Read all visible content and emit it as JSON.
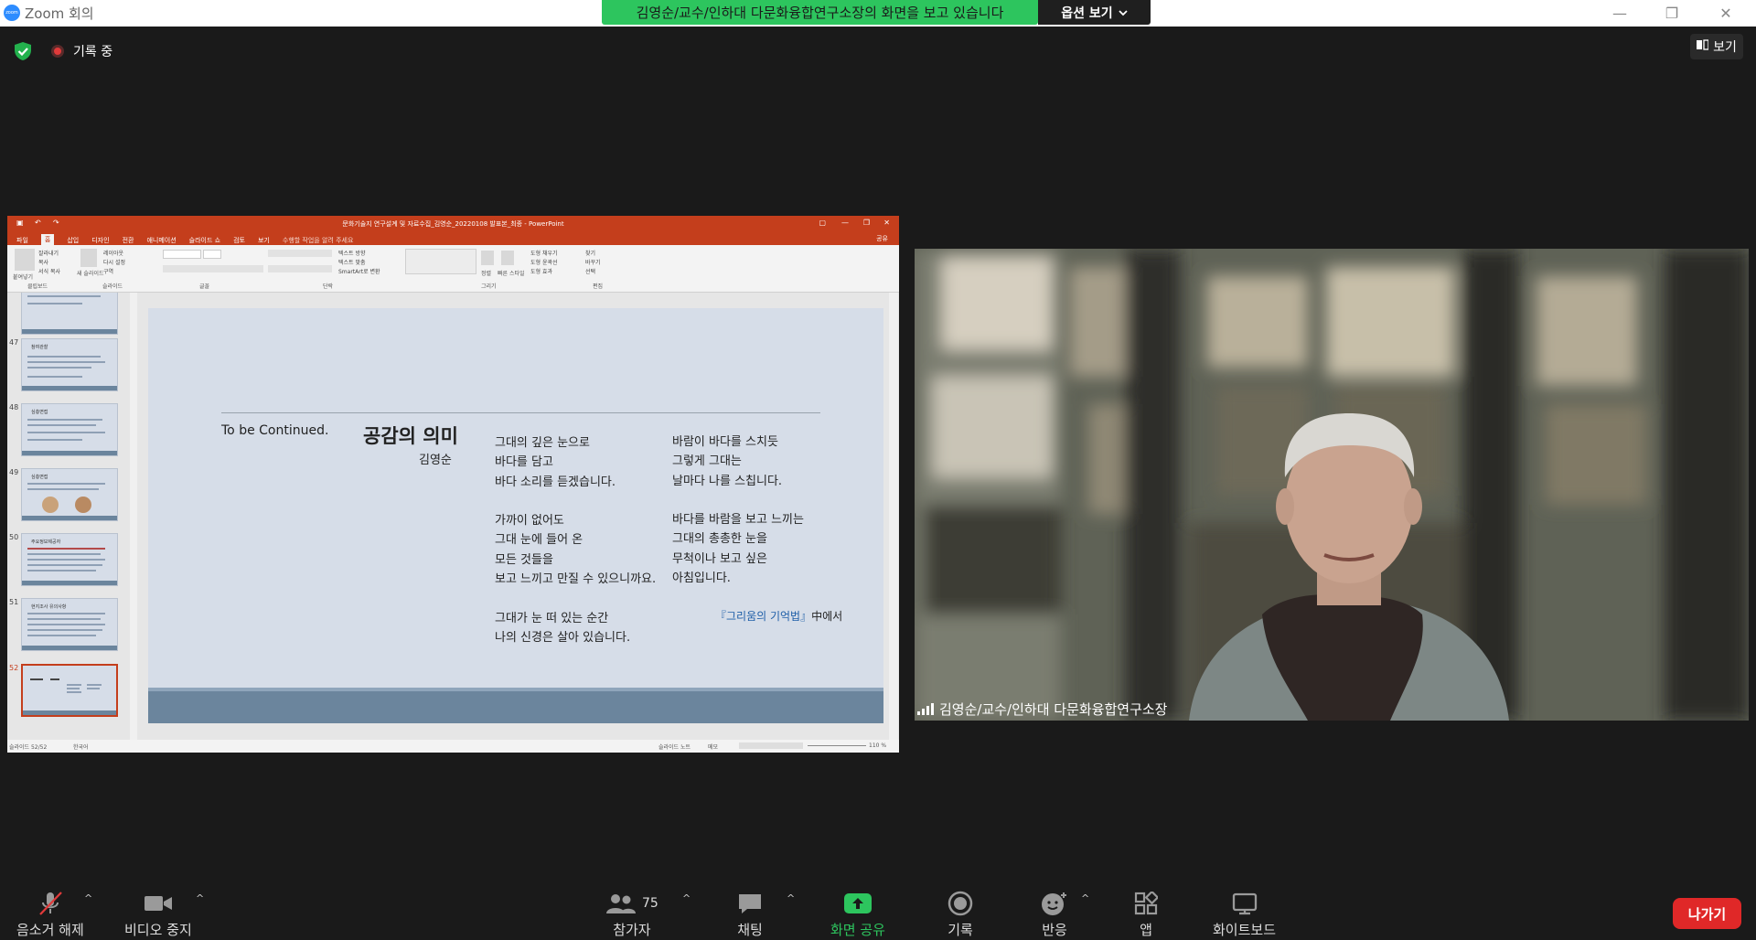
{
  "app": {
    "title": "Zoom 회의",
    "logo_text": "zoom"
  },
  "share_banner": {
    "text": "김영순/교수/인하대 다문화융합연구소장의 화면을 보고 있습니다",
    "options_label": "옵션 보기"
  },
  "window_controls": {
    "minimize": "—",
    "restore": "❐",
    "close": "✕"
  },
  "recording": {
    "label": "기록 중"
  },
  "view_button": {
    "label": "보기"
  },
  "ppt": {
    "title": "문화기술지 연구설계 및 자료수집_김영순_20220108 발표본_최종 - PowerPoint",
    "tabs": [
      "파일",
      "홈",
      "삽입",
      "디자인",
      "전환",
      "애니메이션",
      "슬라이드 쇼",
      "검토",
      "보기"
    ],
    "tell_me": "수행할 작업을 알려 주세요",
    "share": "공유",
    "ribbon_groups": [
      "클립보드",
      "슬라이드",
      "글꼴",
      "단락",
      "그리기",
      "편집"
    ],
    "ribbon_items": {
      "paste": "붙여넣기",
      "cut": "잘라내기",
      "copy": "복사",
      "format_painter": "서식 복사",
      "new_slide": "새 슬라이드",
      "layout": "레이아웃",
      "reset": "다시 설정",
      "section": "구역",
      "text_direction": "텍스트 방향",
      "align_text": "텍스트 맞춤",
      "smartart": "SmartArt로 변환",
      "arrange": "정렬",
      "quick_styles": "빠른 스타일",
      "shape_fill": "도형 채우기",
      "shape_outline": "도형 윤곽선",
      "shape_effects": "도형 효과",
      "find": "찾기",
      "replace": "바꾸기",
      "select": "선택"
    },
    "thumb_numbers": [
      "47",
      "48",
      "49",
      "50",
      "51",
      "52"
    ],
    "thumb_titles": [
      "참여관찰",
      "심층면접",
      "심층면접",
      "주요정보제공자",
      "현지조사 유의사항",
      ""
    ],
    "status": {
      "slide": "슬라이드 52/52",
      "lang": "한국어",
      "notes": "슬라이드 노트",
      "memo": "메모",
      "zoom": "110 %"
    }
  },
  "slide": {
    "tbc": "To be Continued.",
    "poem_title": "공감의 의미",
    "poem_author": "김영순",
    "col1": "그대의 깊은 눈으로\n바다를 담고\n바다 소리를 듣겠습니다.\n\n가까이 없어도\n그대 눈에 들어 온\n모든 것들을\n보고 느끼고 만질 수 있으니까요.\n\n그대가 눈 떠 있는 순간\n나의 신경은 살아 있습니다.",
    "col2": "바람이 바다를 스치듯\n그렇게 그대는\n날마다 나를 스칩니다.\n\n바다를 바람을 보고 느끼는\n그대의 총총한 눈을\n무척이나 보고 싶은\n아침입니다.",
    "source_highlight": "『그리움의 기억법』",
    "source_suffix": "中에서"
  },
  "participant": {
    "name": "김영순/교수/인하대 다문화융합연구소장"
  },
  "toolbar": {
    "unmute": "음소거 해제",
    "stop_video": "비디오 중지",
    "participants": "참가자",
    "participant_count": "75",
    "chat": "채팅",
    "share_screen": "화면 공유",
    "record": "기록",
    "reactions": "반응",
    "apps": "앱",
    "whiteboard": "화이트보드",
    "leave": "나가기",
    "share_color": "#2dc55e",
    "leave_color": "#e02828"
  }
}
